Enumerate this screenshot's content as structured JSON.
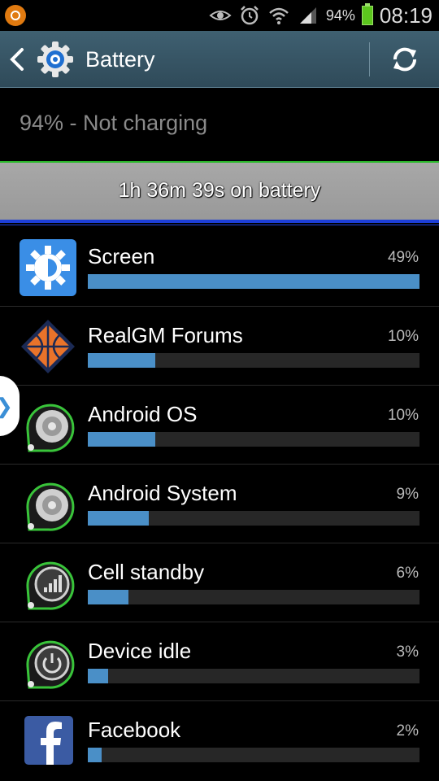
{
  "statusbar": {
    "battery_percent": "94%",
    "time": "08:19",
    "icons": [
      "app-notification-icon",
      "eye-icon",
      "alarm-icon",
      "wifi-icon",
      "signal-icon",
      "battery-icon"
    ]
  },
  "actionbar": {
    "title": "Battery",
    "back_icon": "chevron-left-icon",
    "app_icon": "gear-icon",
    "refresh_icon": "refresh-icon"
  },
  "summary": {
    "status": "94% - Not charging",
    "time_on_battery": "1h 36m 39s on battery"
  },
  "usage": [
    {
      "name": "Screen",
      "percent": "49%",
      "value": 49,
      "icon": "screen-brightness-icon"
    },
    {
      "name": "RealGM Forums",
      "percent": "10%",
      "value": 10,
      "icon": "basketball-icon"
    },
    {
      "name": "Android OS",
      "percent": "10%",
      "value": 10,
      "icon": "android-os-icon"
    },
    {
      "name": "Android System",
      "percent": "9%",
      "value": 9,
      "icon": "android-system-icon"
    },
    {
      "name": "Cell standby",
      "percent": "6%",
      "value": 6,
      "icon": "cell-signal-icon"
    },
    {
      "name": "Device idle",
      "percent": "3%",
      "value": 3,
      "icon": "power-icon"
    },
    {
      "name": "Facebook",
      "percent": "2%",
      "value": 2,
      "icon": "facebook-icon"
    }
  ],
  "colors": {
    "bar": "#4a8fc7",
    "actionbar": "#3f6071",
    "graph_green": "#29b82a",
    "graph_blue": "#1d3fd8"
  }
}
